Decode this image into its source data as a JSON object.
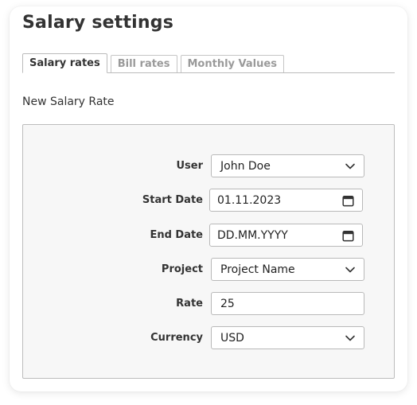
{
  "header": {
    "title": "Salary settings"
  },
  "tabs": [
    {
      "label": "Salary rates",
      "active": true
    },
    {
      "label": "Bill rates",
      "active": false
    },
    {
      "label": "Monthly Values",
      "active": false
    }
  ],
  "form": {
    "title": "New Salary Rate",
    "user": {
      "label": "User",
      "value": "John Doe",
      "icon": "chevron-down-icon"
    },
    "start_date": {
      "label": "Start Date",
      "value": "01.11.2023",
      "icon": "calendar-icon"
    },
    "end_date": {
      "label": "End Date",
      "placeholder": "DD.MM.YYYY",
      "icon": "calendar-icon"
    },
    "project": {
      "label": "Project",
      "value": "Project Name",
      "icon": "chevron-down-icon"
    },
    "rate": {
      "label": "Rate",
      "value": "25"
    },
    "currency": {
      "label": "Currency",
      "value": "USD",
      "icon": "chevron-down-icon"
    }
  },
  "colors": {
    "text": "#333333",
    "muted_tab": "#9a9a9a",
    "panel_bg": "#f7f7f7",
    "border": "#bdbdbd"
  }
}
